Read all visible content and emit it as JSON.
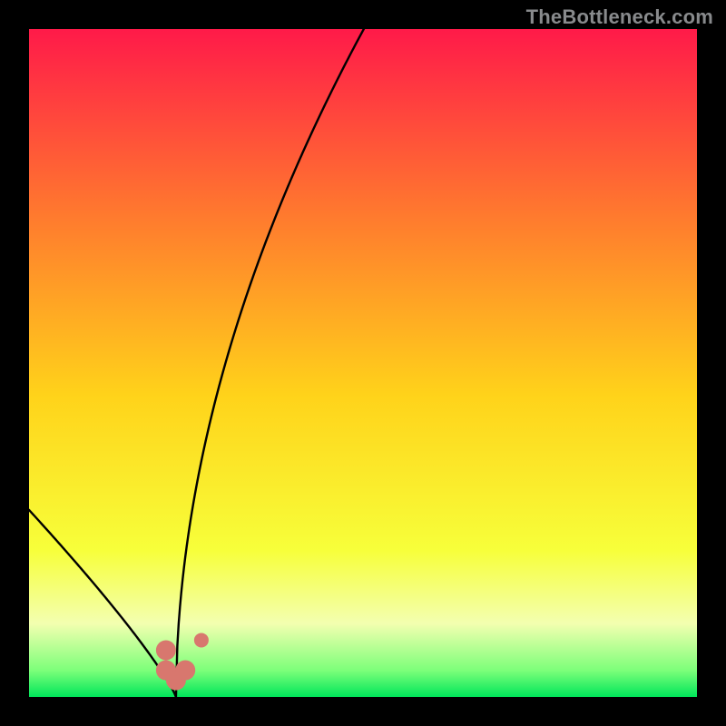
{
  "watermark": "TheBottleneck.com",
  "colors": {
    "top": "#ff1a49",
    "mid_upper": "#ff7a2e",
    "mid": "#ffd31a",
    "mid_lower": "#f7ff3a",
    "pale_band": "#f3ffb0",
    "green": "#00e65a",
    "curve": "#000000",
    "marker": "#d8776e"
  },
  "chart_data": {
    "type": "line",
    "title": "",
    "xlabel": "",
    "ylabel": "",
    "xlim": [
      0,
      100
    ],
    "ylim": [
      0,
      100
    ],
    "series": [
      {
        "name": "bottleneck-curve",
        "x_optimal": 22,
        "scale_left": 28,
        "scale_right": 170,
        "exp_left": 0.86,
        "exp_right": 0.52,
        "comment": "V-shaped curve with minimum near x≈22; steep left branch rises toward top-left, shallower right branch rises toward upper-right (~82 at x=100). y is roughly 100*|x-22|^exp scaled."
      }
    ],
    "markers": [
      {
        "name": "marker-left-lower",
        "x": 20.5,
        "y": 4.0,
        "size": 22
      },
      {
        "name": "marker-left-upper",
        "x": 20.5,
        "y": 7.0,
        "size": 22
      },
      {
        "name": "marker-bottom",
        "x": 22.0,
        "y": 2.5,
        "size": 22
      },
      {
        "name": "marker-right-lower",
        "x": 23.4,
        "y": 4.0,
        "size": 22
      },
      {
        "name": "marker-right-dot",
        "x": 25.8,
        "y": 8.5,
        "size": 16
      }
    ]
  }
}
